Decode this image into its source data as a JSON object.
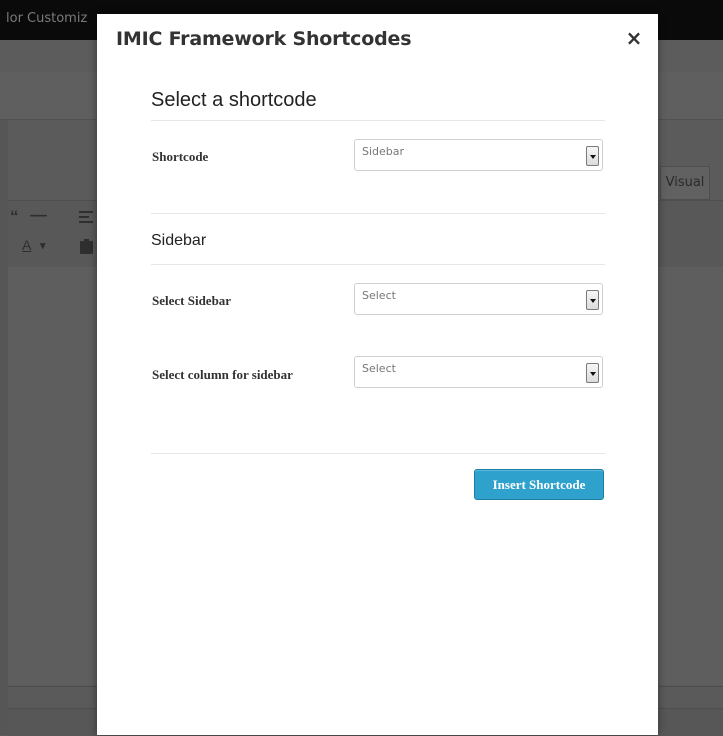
{
  "background": {
    "topbar_text": "lor Customiz",
    "visual_tab": "Visual",
    "toolbar_icons": [
      "quote-icon",
      "horizontal-rule-icon",
      "align-icon",
      "text-color-icon",
      "dropdown-arrow-icon",
      "paste-icon"
    ],
    "toolbar_glyphs": {
      "quote": "“",
      "hr": "—",
      "text_color": "A",
      "dropdown": "▾"
    }
  },
  "modal": {
    "title": "IMIC Framework Shortcodes",
    "close_glyph": "×",
    "select_heading": "Select a shortcode",
    "shortcode_label": "Shortcode",
    "shortcode_value": "Sidebar",
    "sub_heading": "Sidebar",
    "fields": [
      {
        "label": "Select Sidebar",
        "value": "Select"
      },
      {
        "label": "Select column for sidebar",
        "value": "Select"
      }
    ],
    "insert_button": "Insert Shortcode"
  },
  "colors": {
    "overlay": "#5a5a5a",
    "button": "#2ea2cc",
    "button_border": "#1f7ea3"
  }
}
